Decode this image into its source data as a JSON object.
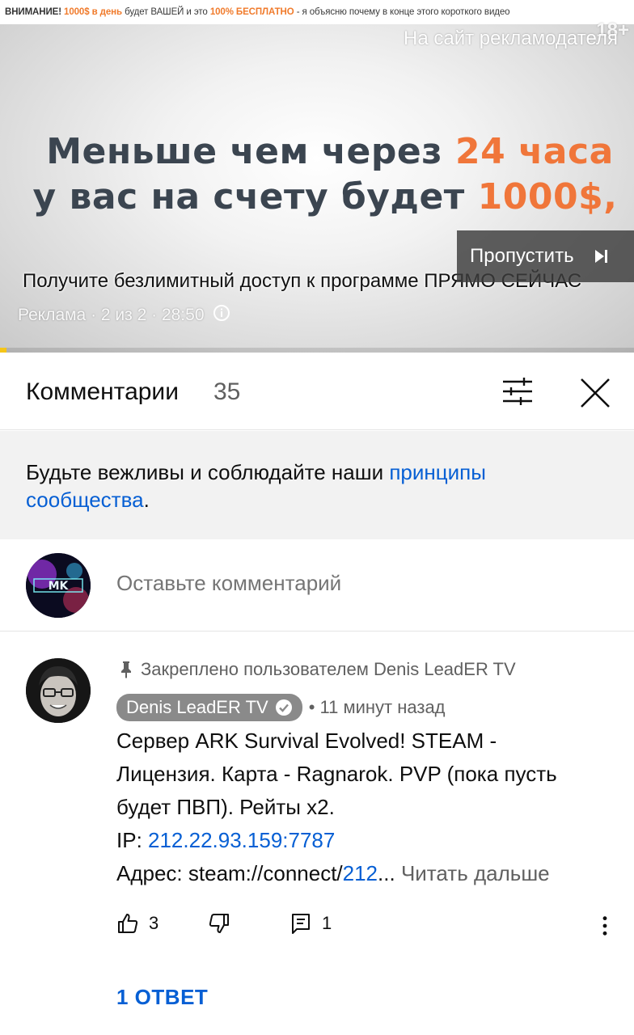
{
  "ad": {
    "banner": {
      "part1": "ВНИМАНИЕ!",
      "part2": "1000$ в день",
      "part3": "будет ВАШЕЙ и это",
      "part4": "100% БЕСПЛАТНО",
      "part5": "- я объясню почему в конце этого короткого видео"
    },
    "advertiser_link": "На сайт рекламодателя",
    "age_rating": "18+",
    "headline_line1_a": "Меньше чем через ",
    "headline_line1_b": "24 часа",
    "headline_line2_a": "у вас на счету будет ",
    "headline_line2_b": "1000$,",
    "caption": "Получите безлимитный доступ к программе ПРЯМО СЕЙЧАС",
    "skip_label": "Пропустить",
    "meta": "Реклама · 2 из 2 · 28:50",
    "progress_fraction": 0.01
  },
  "comments_header": {
    "title": "Комментарии",
    "count": "35"
  },
  "notice": {
    "text": "Будьте вежливы и соблюдайте наши ",
    "link": "принципы сообщества",
    "end": "."
  },
  "add_comment": {
    "placeholder": "Оставьте комментарий"
  },
  "pinned_comment": {
    "pinned_label": "Закреплено пользователем Denis LeadER TV",
    "author": "Denis LeadER TV",
    "timestamp": "• 11 минут назад",
    "line1": "Сервер ARK Survival Evolved! STEAM -",
    "line2": "Лицензия. Карта - Ragnarok. PVP (пока пусть",
    "line3": "будет ПВП). Рейты x2.",
    "ip_label": "IP: ",
    "ip_value": "212.22.93.159:7787",
    "address_label": "Адрес: steam://connect/",
    "address_link": "212",
    "address_ellipsis": "...",
    "read_more": "Читать дальше",
    "likes": "3",
    "reply_count": "1",
    "replies_button": "1 ОТВЕТ"
  },
  "colors": {
    "link_blue": "#065fd4",
    "ad_orange": "#f0763a",
    "ad_progress": "#f5c518"
  },
  "icons": {
    "filter": "sliders-icon",
    "close": "close-icon",
    "pin": "pin-icon",
    "verified": "verified-check-icon",
    "like": "thumb-up-icon",
    "dislike": "thumb-down-icon",
    "reply": "comment-icon",
    "menu": "more-vertical-icon",
    "skip": "skip-next-icon",
    "info": "info-icon"
  }
}
